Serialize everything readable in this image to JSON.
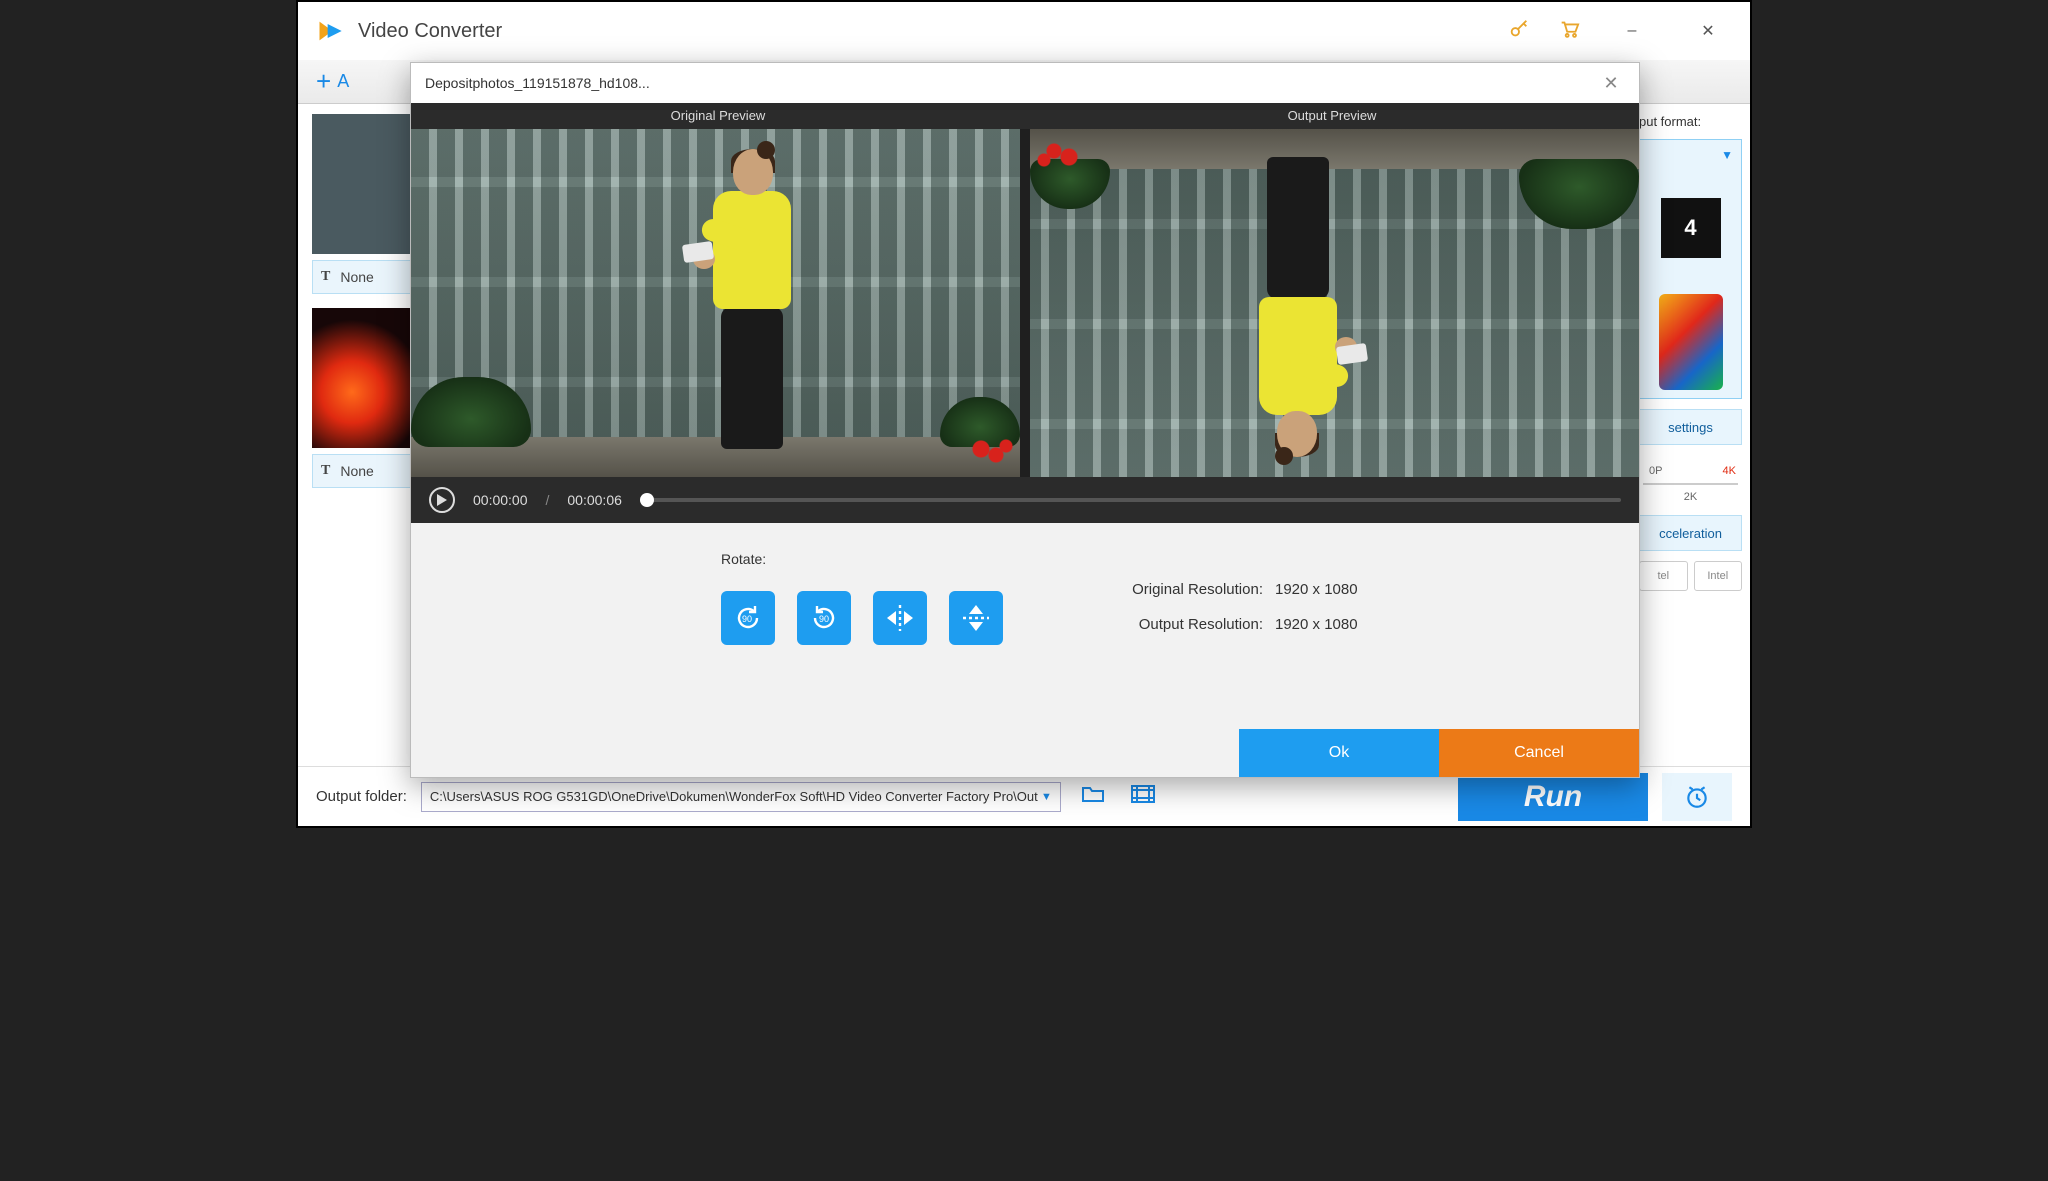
{
  "app": {
    "title": "Video Converter"
  },
  "window_controls": {
    "minimize": "–",
    "close": "✕"
  },
  "toolbar": {
    "add_label": "A"
  },
  "list": {
    "subtitle_none": "None"
  },
  "side": {
    "output_format_label": "put format:",
    "mp4_label": "4",
    "param_label": "settings",
    "res_1080": "0P",
    "res_4k": "4K",
    "res_2k": "2K",
    "accel_label": "cceleration",
    "chip_intel": "Intel",
    "chip_intel_badge": "tel"
  },
  "footer": {
    "label": "Output folder:",
    "path": "C:\\Users\\ASUS ROG G531GD\\OneDrive\\Dokumen\\WonderFox Soft\\HD Video Converter Factory Pro\\Out",
    "run": "Run"
  },
  "modal": {
    "title": "Depositphotos_119151878_hd108...",
    "orig_header": "Original Preview",
    "out_header": "Output Preview",
    "time_current": "00:00:00",
    "time_total": "00:00:06",
    "rotate_label": "Rotate:",
    "orig_res_label": "Original Resolution:",
    "orig_res_value": "1920 x 1080",
    "out_res_label": "Output Resolution:",
    "out_res_value": "1920 x 1080",
    "ok": "Ok",
    "cancel": "Cancel"
  }
}
